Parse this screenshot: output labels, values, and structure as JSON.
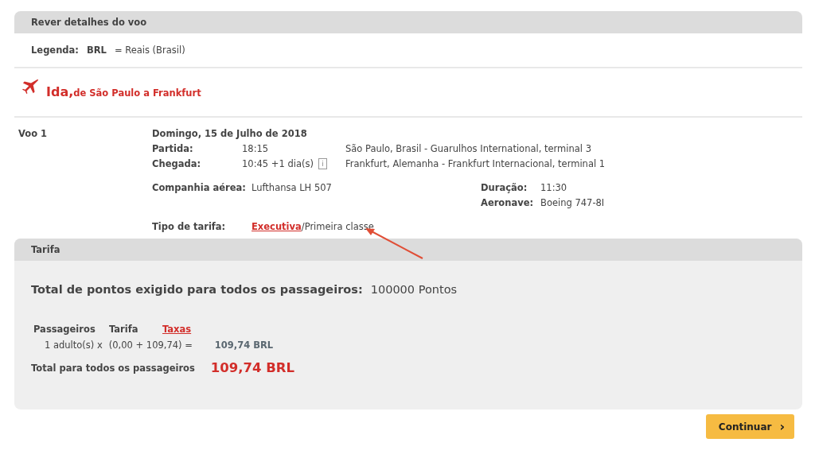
{
  "review_header": {
    "title": "Rever detalhes do voo"
  },
  "legend": {
    "label": "Legenda:",
    "code": "BRL",
    "meaning": "= Reais (Brasil)"
  },
  "direction": {
    "title": "Ida,",
    "route": "de São Paulo a Frankfurt"
  },
  "flight": {
    "name": "Voo 1",
    "date": "Domingo, 15 de Julho de 2018",
    "departure": {
      "label": "Partida:",
      "time": "18:15",
      "place": "São Paulo, Brasil - Guarulhos International, terminal 3"
    },
    "arrival": {
      "label": "Chegada:",
      "time": "10:45 +1 dia(s)",
      "info_icon": "i",
      "place": "Frankfurt, Alemanha - Frankfurt Internacional, terminal 1"
    },
    "airline": {
      "label": "Companhia aérea:",
      "value": "Lufthansa LH 507"
    },
    "duration": {
      "label": "Duração:",
      "value": "11:30"
    },
    "aircraft": {
      "label": "Aeronave:",
      "value": "Boeing 747-8I"
    },
    "fare_type": {
      "label": "Tipo de tarifa:",
      "link": "Executiva",
      "rest": "/Primeira classe"
    }
  },
  "fare": {
    "header": "Tarifa",
    "points_label": "Total de pontos exigido para todos os passageiros:",
    "points_value": "100000 Pontos",
    "columns": [
      "Passageiros",
      "Tarifa",
      "Taxas"
    ],
    "row": {
      "passengers": "1 adulto(s) x",
      "formula": "(0,00 + 109,74) =",
      "amount": "109,74 BRL"
    },
    "total_label": "Total para todos os passageiros",
    "total_value": "109,74 BRL"
  },
  "continue_button": {
    "label": "Continuar",
    "chevron": "›"
  }
}
